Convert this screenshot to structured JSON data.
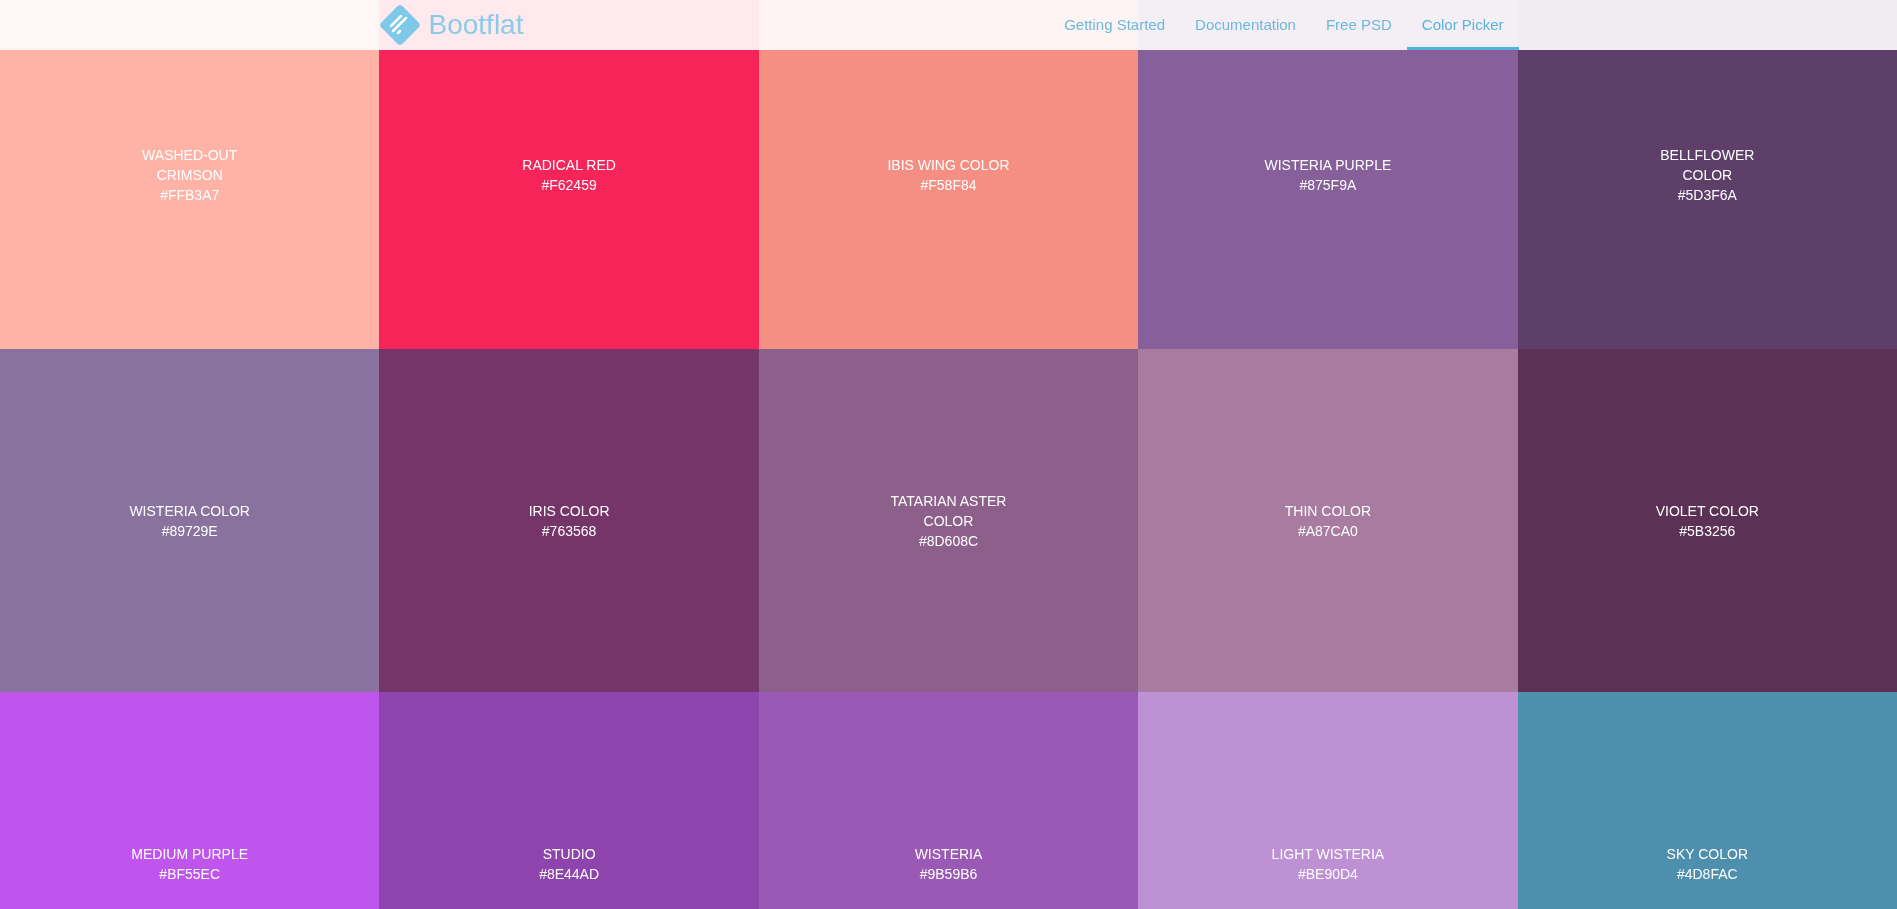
{
  "header": {
    "logo": "Bootflat",
    "nav": [
      {
        "label": "Getting Started",
        "selected": false
      },
      {
        "label": "Documentation",
        "selected": false
      },
      {
        "label": "Free PSD",
        "selected": false
      },
      {
        "label": "Color Picker",
        "selected": true
      }
    ]
  },
  "swatches": [
    {
      "name": "WASHED-OUT CRIMSON",
      "hex": "#FFB3A7",
      "color": "#ffb3a7"
    },
    {
      "name": "RADICAL RED",
      "hex": "#F62459",
      "color": "#f62459"
    },
    {
      "name": "IBIS WING COLOR",
      "hex": "#F58F84",
      "color": "#f58f84"
    },
    {
      "name": "WISTERIA PURPLE",
      "hex": "#875F9A",
      "color": "#875f9a"
    },
    {
      "name": "BELLFLOWER COLOR",
      "hex": "#5D3F6A",
      "color": "#5d3f6a"
    },
    {
      "name": "WISTERIA COLOR",
      "hex": "#89729E",
      "color": "#89729e"
    },
    {
      "name": "IRIS COLOR",
      "hex": "#763568",
      "color": "#763568"
    },
    {
      "name": "TATARIAN ASTER COLOR",
      "hex": "#8D608C",
      "color": "#8d608c"
    },
    {
      "name": "THIN COLOR",
      "hex": "#A87CA0",
      "color": "#a87ca0"
    },
    {
      "name": "VIOLET COLOR",
      "hex": "#5B3256",
      "color": "#5b3256"
    },
    {
      "name": "MEDIUM PURPLE",
      "hex": "#BF55EC",
      "color": "#bf55ec"
    },
    {
      "name": "STUDIO",
      "hex": "#8E44AD",
      "color": "#8e44ad"
    },
    {
      "name": "WISTERIA",
      "hex": "#9B59B6",
      "color": "#9b59b6"
    },
    {
      "name": "LIGHT WISTERIA",
      "hex": "#BE90D4",
      "color": "#be90d4"
    },
    {
      "name": "SKY COLOR",
      "hex": "#4D8FAC",
      "color": "#4d8fac"
    }
  ]
}
